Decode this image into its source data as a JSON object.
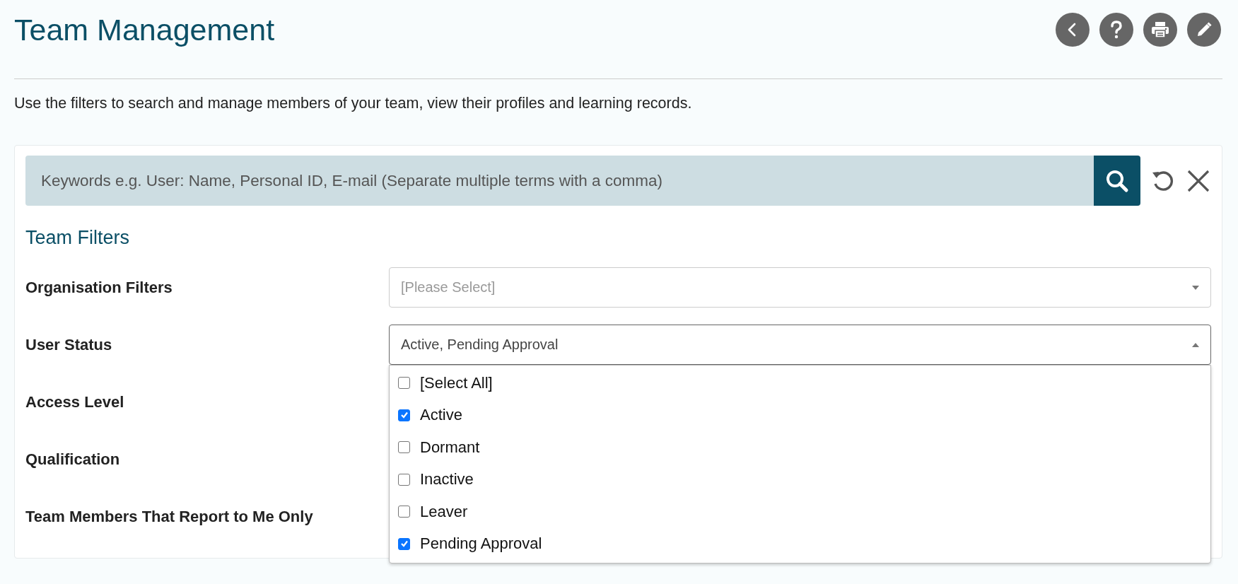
{
  "page": {
    "title": "Team Management",
    "description": "Use the filters to search and manage members of your team, view their profiles and learning records."
  },
  "search": {
    "placeholder": "Keywords e.g. User: Name, Personal ID, E-mail (Separate multiple terms with a comma)"
  },
  "filters": {
    "heading": "Team Filters",
    "rows": [
      {
        "label": "Organisation Filters",
        "kind": "select",
        "placeholder": "[Please Select]",
        "expanded": false
      },
      {
        "label": "User Status",
        "kind": "select",
        "value": "Active, Pending Approval",
        "expanded": true,
        "options": [
          {
            "label": "[Select All]",
            "checked": false
          },
          {
            "label": "Active",
            "checked": true
          },
          {
            "label": "Dormant",
            "checked": false
          },
          {
            "label": "Inactive",
            "checked": false
          },
          {
            "label": "Leaver",
            "checked": false
          },
          {
            "label": "Pending Approval",
            "checked": true
          }
        ]
      },
      {
        "label": "Access Level",
        "kind": "hidden"
      },
      {
        "label": "Qualification",
        "kind": "hidden"
      },
      {
        "label": "Team Members That Report to Me Only",
        "kind": "hidden"
      }
    ]
  }
}
